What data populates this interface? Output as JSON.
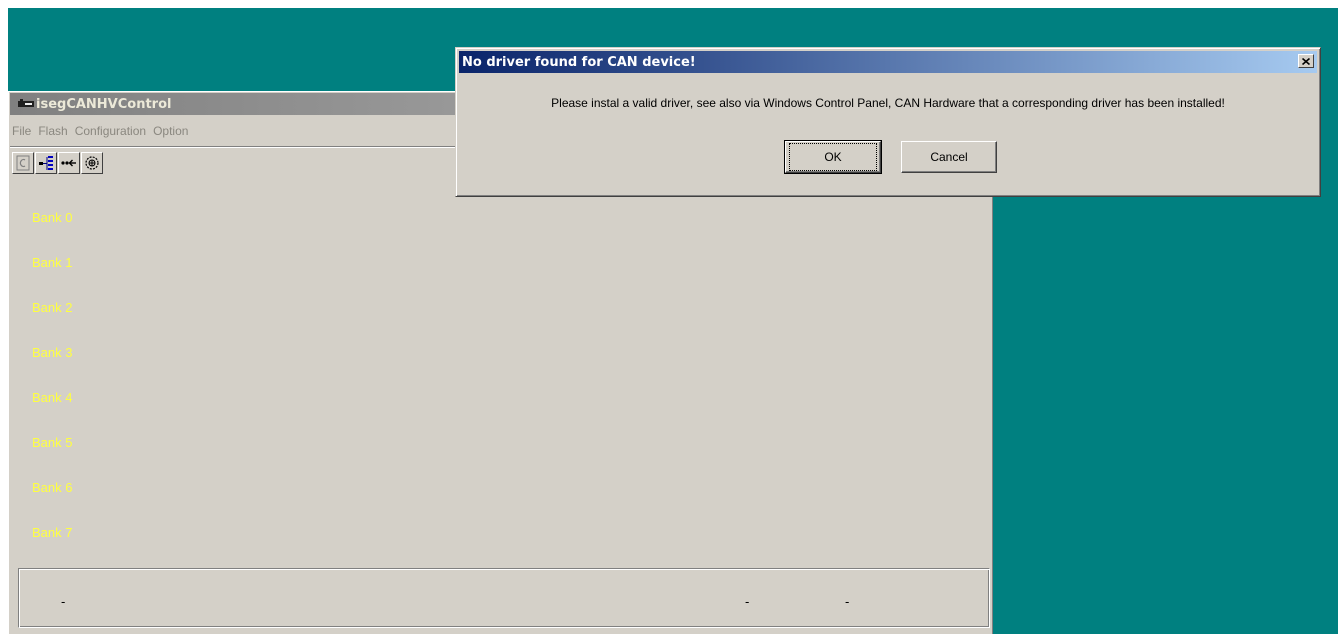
{
  "app": {
    "title": "isegCANHVControl",
    "menu": [
      "File",
      "Flash",
      "Configuration",
      "Option"
    ],
    "toolbar": [
      {
        "icon": "connect-icon"
      },
      {
        "icon": "tree-icon"
      },
      {
        "icon": "arrows-in-icon"
      },
      {
        "icon": "settings-icon"
      }
    ],
    "banks": [
      "Bank 0",
      "Bank 1",
      "Bank 2",
      "Bank 3",
      "Bank 4",
      "Bank 5",
      "Bank 6",
      "Bank 7"
    ],
    "status": {
      "left": "-",
      "middle": "-",
      "right": "-"
    }
  },
  "dialog": {
    "title": "No driver found for CAN device!",
    "message": "Please instal a valid driver, see also via Windows Control Panel, CAN Hardware that a corresponding driver has been installed!",
    "ok_label": "OK",
    "cancel_label": "Cancel"
  },
  "colors": {
    "desktop": "#008080",
    "window_face": "#d4d0c8",
    "bank_text": "#ffff40",
    "dialog_title_start": "#0a246a",
    "dialog_title_end": "#a6caf0"
  }
}
